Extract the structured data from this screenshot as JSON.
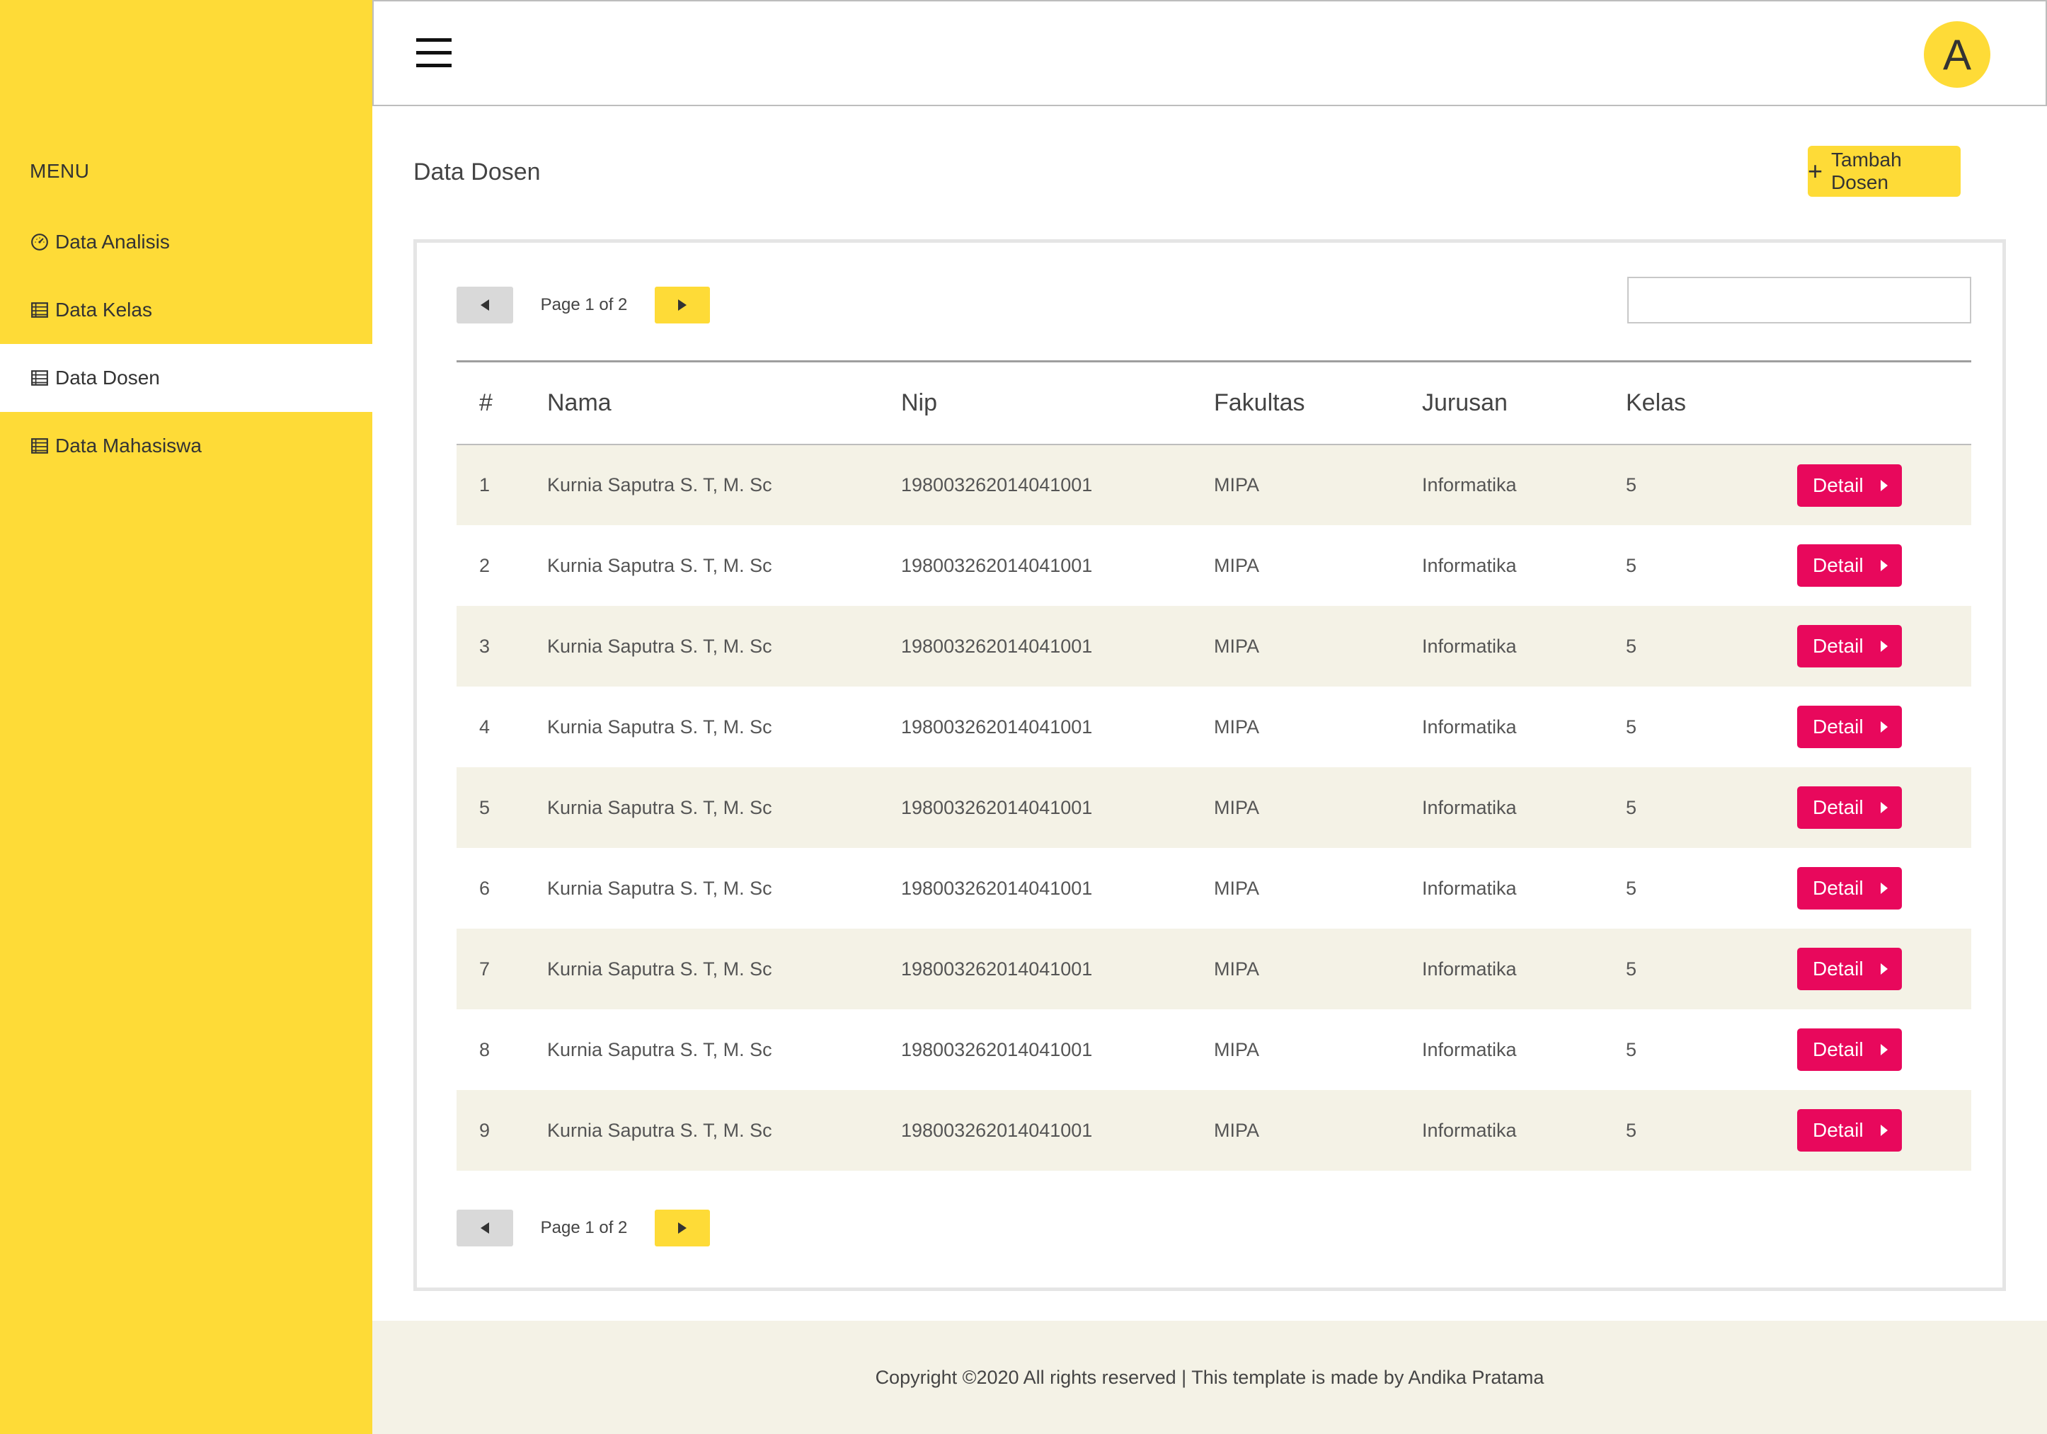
{
  "sidebar": {
    "menu_title": "MENU",
    "items": [
      {
        "label": "Data Analisis",
        "icon": "dashboard-icon"
      },
      {
        "label": "Data Kelas",
        "icon": "table-icon"
      },
      {
        "label": "Data Dosen",
        "icon": "table-icon",
        "active": true
      },
      {
        "label": "Data Mahasiswa",
        "icon": "table-icon"
      }
    ]
  },
  "topbar": {
    "menu_icon": "hamburger-icon",
    "avatar_letter": "A"
  },
  "main": {
    "title": "Data Dosen",
    "add_button_label": "Tambah Dosen",
    "pager_top": {
      "info": "Page 1 of 2"
    },
    "pager_bottom": {
      "info": "Page 1 of 2"
    },
    "search": {
      "value": "",
      "placeholder": ""
    },
    "table": {
      "columns": [
        "#",
        "Nama",
        "Nip",
        "Fakultas",
        "Jurusan",
        "Kelas"
      ],
      "rows": [
        {
          "no": "1",
          "nama": "Kurnia Saputra S. T, M. Sc",
          "nip": "198003262014041001",
          "fakultas": "MIPA",
          "jurusan": "Informatika",
          "kelas": "5",
          "action": "Detail"
        },
        {
          "no": "2",
          "nama": "Kurnia Saputra S. T, M. Sc",
          "nip": "198003262014041001",
          "fakultas": "MIPA",
          "jurusan": "Informatika",
          "kelas": "5",
          "action": "Detail"
        },
        {
          "no": "3",
          "nama": "Kurnia Saputra S. T, M. Sc",
          "nip": "198003262014041001",
          "fakultas": "MIPA",
          "jurusan": "Informatika",
          "kelas": "5",
          "action": "Detail"
        },
        {
          "no": "4",
          "nama": "Kurnia Saputra S. T, M. Sc",
          "nip": "198003262014041001",
          "fakultas": "MIPA",
          "jurusan": "Informatika",
          "kelas": "5",
          "action": "Detail"
        },
        {
          "no": "5",
          "nama": "Kurnia Saputra S. T, M. Sc",
          "nip": "198003262014041001",
          "fakultas": "MIPA",
          "jurusan": "Informatika",
          "kelas": "5",
          "action": "Detail"
        },
        {
          "no": "6",
          "nama": "Kurnia Saputra S. T, M. Sc",
          "nip": "198003262014041001",
          "fakultas": "MIPA",
          "jurusan": "Informatika",
          "kelas": "5",
          "action": "Detail"
        },
        {
          "no": "7",
          "nama": "Kurnia Saputra S. T, M. Sc",
          "nip": "198003262014041001",
          "fakultas": "MIPA",
          "jurusan": "Informatika",
          "kelas": "5",
          "action": "Detail"
        },
        {
          "no": "8",
          "nama": "Kurnia Saputra S. T, M. Sc",
          "nip": "198003262014041001",
          "fakultas": "MIPA",
          "jurusan": "Informatika",
          "kelas": "5",
          "action": "Detail"
        },
        {
          "no": "9",
          "nama": "Kurnia Saputra S. T, M. Sc",
          "nip": "198003262014041001",
          "fakultas": "MIPA",
          "jurusan": "Informatika",
          "kelas": "5",
          "action": "Detail"
        }
      ]
    }
  },
  "footer": {
    "text": "Copyright ©2020 All rights reserved | This template is made by Andika Pratama"
  },
  "colors": {
    "brand_yellow": "#fedb37",
    "detail_red": "#e8085c",
    "stripe": "#f4f2e6"
  }
}
